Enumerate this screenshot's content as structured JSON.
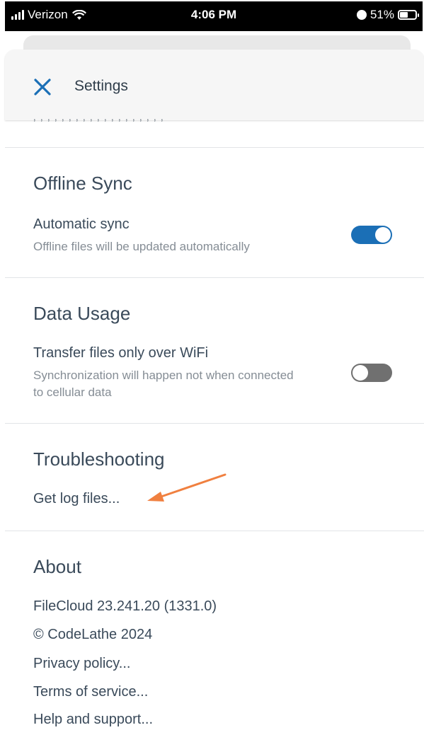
{
  "status_bar": {
    "carrier": "Verizon",
    "time": "4:06 PM",
    "battery_text": "51%",
    "battery_level": 0.51
  },
  "header": {
    "title": "Settings",
    "close_icon": "close-x-icon"
  },
  "offline_sync": {
    "title": "Offline Sync",
    "auto_sync": {
      "label": "Automatic sync",
      "description": "Offline files will be updated automatically",
      "enabled": true
    }
  },
  "data_usage": {
    "title": "Data Usage",
    "wifi_only": {
      "label": "Transfer files only over WiFi",
      "description": "Synchronization will happen not when connected to cellular data",
      "enabled": false
    }
  },
  "troubleshooting": {
    "title": "Troubleshooting",
    "get_logs": "Get log files..."
  },
  "about": {
    "title": "About",
    "version": "FileCloud 23.241.20 (1331.0)",
    "copyright": "© CodeLathe 2024",
    "privacy": "Privacy policy...",
    "terms": "Terms of service...",
    "help": "Help and support..."
  },
  "colors": {
    "accent": "#1b6fb6",
    "annotation_arrow": "#f08040",
    "text": "#3a4a5a",
    "subtext": "#858d95"
  }
}
